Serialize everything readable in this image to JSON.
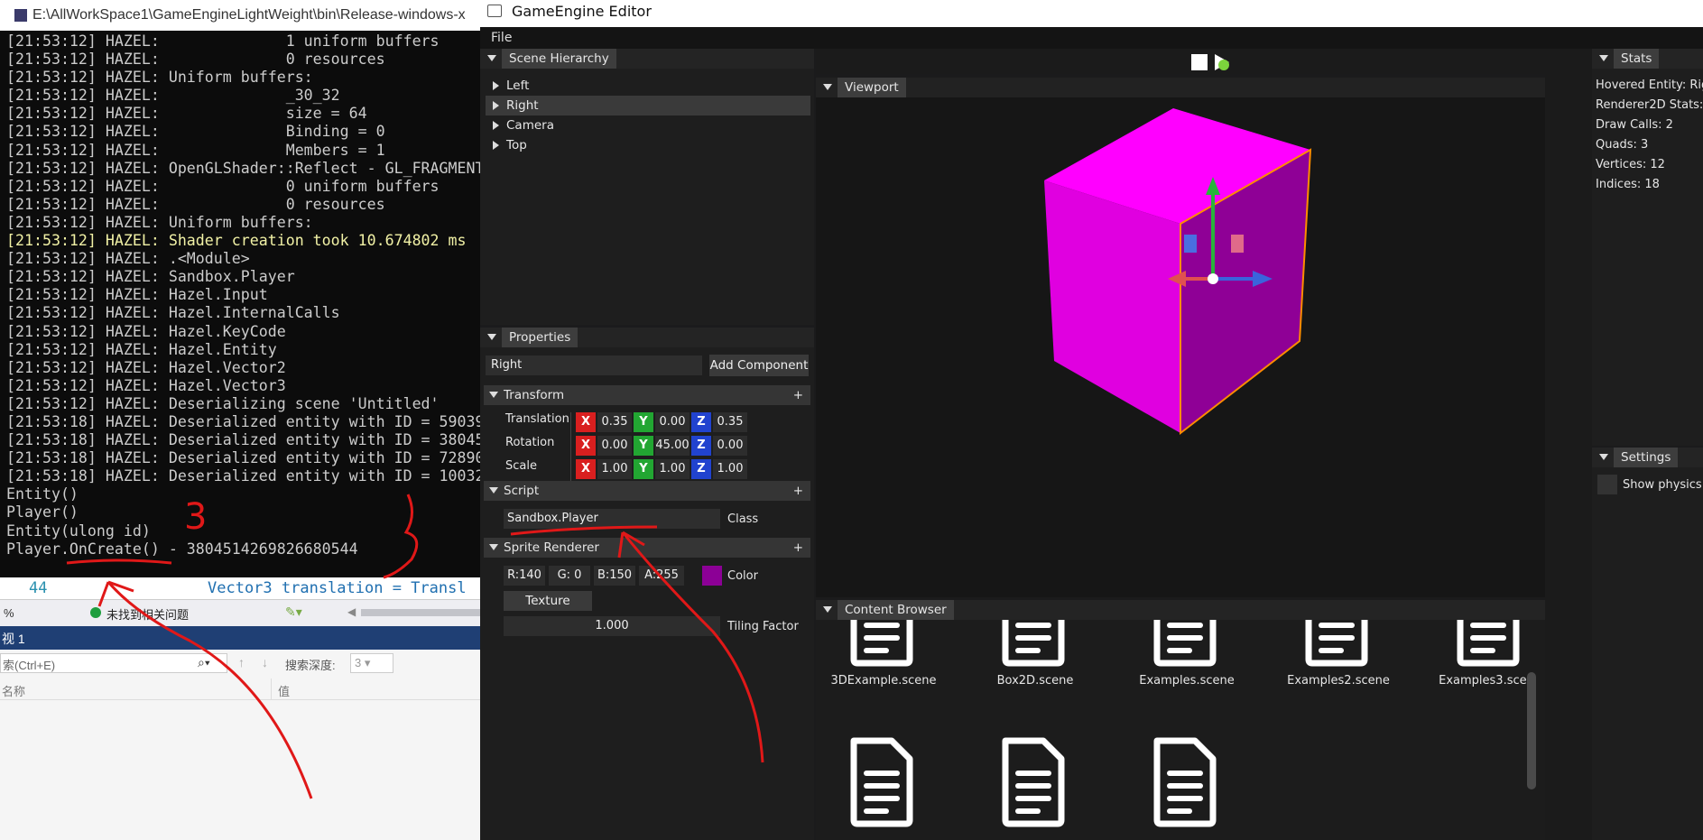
{
  "console": {
    "title": "E:\\AllWorkSpace1\\GameEngineLightWeight\\bin\\Release-windows-x",
    "lines": [
      {
        "t": "[21:53:12] HAZEL:              1 uniform buffers",
        "c": ""
      },
      {
        "t": "[21:53:12] HAZEL:              0 resources",
        "c": ""
      },
      {
        "t": "[21:53:12] HAZEL: Uniform buffers:",
        "c": ""
      },
      {
        "t": "[21:53:12] HAZEL:              _30_32",
        "c": ""
      },
      {
        "t": "[21:53:12] HAZEL:              size = 64",
        "c": ""
      },
      {
        "t": "[21:53:12] HAZEL:              Binding = 0",
        "c": ""
      },
      {
        "t": "[21:53:12] HAZEL:              Members = 1",
        "c": ""
      },
      {
        "t": "[21:53:12] HAZEL: OpenGLShader::Reflect - GL_FRAGMENT",
        "c": ""
      },
      {
        "t": "[21:53:12] HAZEL:              0 uniform buffers",
        "c": ""
      },
      {
        "t": "[21:53:12] HAZEL:              0 resources",
        "c": ""
      },
      {
        "t": "[21:53:12] HAZEL: Uniform buffers:",
        "c": ""
      },
      {
        "t": "[21:53:12] HAZEL: Shader creation took 10.674802 ms",
        "c": "yl"
      },
      {
        "t": "[21:53:12] HAZEL: .<Module>",
        "c": ""
      },
      {
        "t": "[21:53:12] HAZEL: Sandbox.Player",
        "c": ""
      },
      {
        "t": "[21:53:12] HAZEL: Hazel.Input",
        "c": ""
      },
      {
        "t": "[21:53:12] HAZEL: Hazel.InternalCalls",
        "c": ""
      },
      {
        "t": "[21:53:12] HAZEL: Hazel.KeyCode",
        "c": ""
      },
      {
        "t": "[21:53:12] HAZEL: Hazel.Entity",
        "c": ""
      },
      {
        "t": "[21:53:12] HAZEL: Hazel.Vector2",
        "c": ""
      },
      {
        "t": "[21:53:12] HAZEL: Hazel.Vector3",
        "c": ""
      },
      {
        "t": "[21:53:12] HAZEL: Deserializing scene 'Untitled'",
        "c": ""
      },
      {
        "t": "[21:53:18] HAZEL: Deserialized entity with ID = 59039",
        "c": ""
      },
      {
        "t": "[21:53:18] HAZEL: Deserialized entity with ID = 38045",
        "c": ""
      },
      {
        "t": "[21:53:18] HAZEL: Deserialized entity with ID = 72890",
        "c": ""
      },
      {
        "t": "[21:53:18] HAZEL: Deserialized entity with ID = 10032",
        "c": ""
      },
      {
        "t": "Entity()",
        "c": ""
      },
      {
        "t": "Player()",
        "c": ""
      },
      {
        "t": "Entity(ulong id)",
        "c": ""
      },
      {
        "t": "Player.OnCreate() - 3804514269826680544",
        "c": ""
      }
    ]
  },
  "vs": {
    "line_no": "44",
    "code": "Vector3 translation = Transl",
    "zoom": "%",
    "status": "未找到相关问题",
    "panel_title": "视 1",
    "search_placeholder": "索(Ctrl+E)",
    "search_depth_label": "搜索深度:",
    "search_depth_value": "3",
    "col_name": "名称",
    "col_value": "值"
  },
  "editor": {
    "title": "GameEngine Editor",
    "menu_file": "File",
    "hierarchy": {
      "title": "Scene Hierarchy",
      "items": [
        "Left",
        "Right",
        "Camera",
        "Top"
      ],
      "selected": "Right"
    },
    "properties": {
      "title": "Properties",
      "entity_name": "Right",
      "add_component": "Add Component",
      "transform": {
        "title": "Transform",
        "rows": [
          {
            "label": "Translation",
            "x": "0.35",
            "y": "0.00",
            "z": "0.35"
          },
          {
            "label": "Rotation",
            "x": "0.00",
            "y": "45.00",
            "z": "0.00"
          },
          {
            "label": "Scale",
            "x": "1.00",
            "y": "1.00",
            "z": "1.00"
          }
        ]
      },
      "script": {
        "title": "Script",
        "class_value": "Sandbox.Player",
        "class_label": "Class"
      },
      "sprite": {
        "title": "Sprite Renderer",
        "r": "R:140",
        "g": "G: 0",
        "b": "B:150",
        "a": "A:255",
        "color_label": "Color",
        "color_hex": "#8c0096",
        "texture_button": "Texture",
        "tiling_value": "1.000",
        "tiling_label": "Tiling Factor"
      },
      "plus": "+"
    },
    "viewport": {
      "title": "Viewport",
      "cube_color": "#ff00ff"
    },
    "stats": {
      "title": "Stats",
      "lines": [
        "Hovered Entity: Rig",
        "Renderer2D Stats:",
        "Draw Calls: 2",
        "Quads: 3",
        "Vertices: 12",
        "Indices: 18"
      ]
    },
    "settings": {
      "title": "Settings",
      "show_physics": "Show physics c"
    },
    "content_browser": {
      "title": "Content Browser",
      "files": [
        "3DExample.scene",
        "Box2D.scene",
        "Examples.scene",
        "Examples2.scene",
        "Examples3.scene"
      ]
    }
  },
  "annotations": {
    "num_3a": "3",
    "num_3b": "3"
  }
}
